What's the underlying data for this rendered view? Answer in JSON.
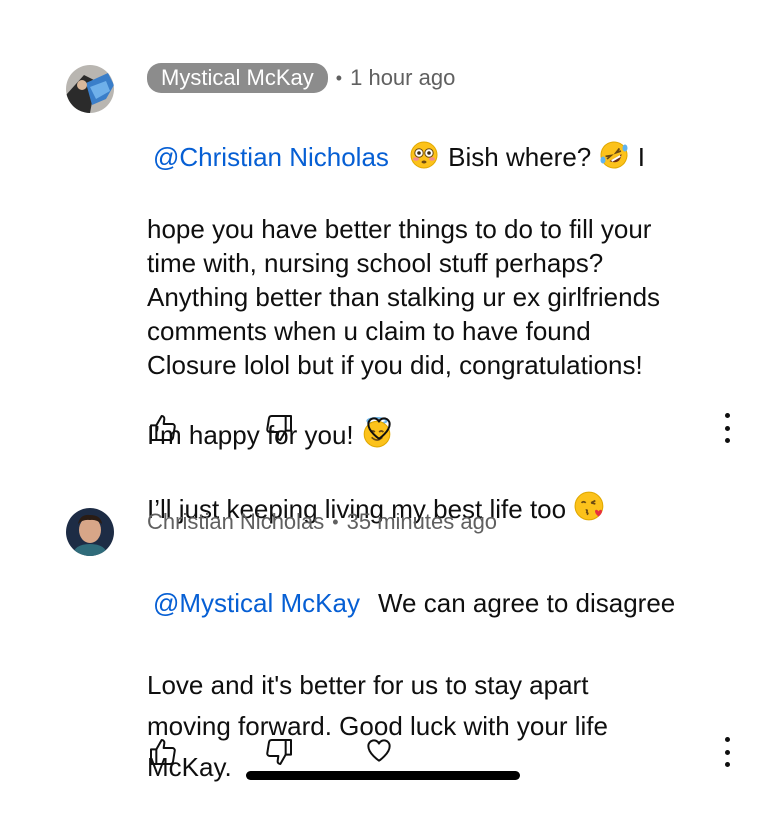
{
  "comments": [
    {
      "author": "Mystical McKay",
      "time": "1 hour ago",
      "mention": "@Christian Nicholas",
      "line1_after": "Bish where?",
      "line1_tail": "I",
      "body_lines": "hope you have better things to do to fill your\ntime with, nursing school stuff perhaps?\nAnything better than stalking ur ex girlfriends\ncomments when u claim to have found\nClosure lolol but if you did, congratulations!",
      "happy_line": "I’m happy for you!",
      "last_line": "I’ll just keeping living my best life too",
      "emojis": [
        "flushed-face",
        "rolling-laughing-face",
        "smiling-face-with-halo",
        "face-blowing-kiss"
      ]
    },
    {
      "author": "Christian Nicholas",
      "time": "35 minutes ago",
      "mention": "@Mystical McKay",
      "line1_after": "We can agree to disagree",
      "body_lines": "Love and it's better for us to stay apart\nmoving forward. Good luck with your life\nMcKay."
    }
  ],
  "actions": {
    "icons": [
      "thumbs-up-icon",
      "thumbs-down-icon",
      "heart-icon",
      "more-vert-icon"
    ]
  },
  "colors": {
    "mention": "#065fd4",
    "meta": "#606060",
    "chip": "#8c8c8c",
    "text": "#0f0f0f"
  }
}
